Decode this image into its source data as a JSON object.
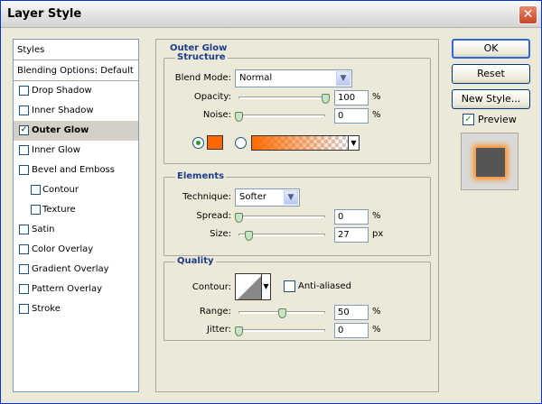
{
  "window": {
    "title": "Layer Style",
    "close_glyph": "✕"
  },
  "styles_panel": {
    "header": "Styles",
    "blending_options": "Blending Options: Default",
    "items": [
      {
        "label": "Drop Shadow",
        "checked": false,
        "indent": false,
        "selected": false
      },
      {
        "label": "Inner Shadow",
        "checked": false,
        "indent": false,
        "selected": false
      },
      {
        "label": "Outer Glow",
        "checked": true,
        "indent": false,
        "selected": true
      },
      {
        "label": "Inner Glow",
        "checked": false,
        "indent": false,
        "selected": false
      },
      {
        "label": "Bevel and Emboss",
        "checked": false,
        "indent": false,
        "selected": false
      },
      {
        "label": "Contour",
        "checked": false,
        "indent": true,
        "selected": false
      },
      {
        "label": "Texture",
        "checked": false,
        "indent": true,
        "selected": false
      },
      {
        "label": "Satin",
        "checked": false,
        "indent": false,
        "selected": false
      },
      {
        "label": "Color Overlay",
        "checked": false,
        "indent": false,
        "selected": false
      },
      {
        "label": "Gradient Overlay",
        "checked": false,
        "indent": false,
        "selected": false
      },
      {
        "label": "Pattern Overlay",
        "checked": false,
        "indent": false,
        "selected": false
      },
      {
        "label": "Stroke",
        "checked": false,
        "indent": false,
        "selected": false
      }
    ]
  },
  "outer_glow": {
    "title": "Outer Glow",
    "structure": {
      "title": "Structure",
      "blend_mode_label": "Blend Mode:",
      "blend_mode_value": "Normal",
      "opacity_label": "Opacity:",
      "opacity_value": "100",
      "opacity_pct": 1.0,
      "noise_label": "Noise:",
      "noise_value": "0",
      "noise_pct": 0.0,
      "unit_percent": "%",
      "glow_color": "#ff6600"
    },
    "elements": {
      "title": "Elements",
      "technique_label": "Technique:",
      "technique_value": "Softer",
      "spread_label": "Spread:",
      "spread_value": "0",
      "spread_pct": 0.0,
      "size_label": "Size:",
      "size_value": "27",
      "size_pct": 0.11,
      "unit_percent": "%",
      "unit_px": "px"
    },
    "quality": {
      "title": "Quality",
      "contour_label": "Contour:",
      "anti_aliased_label": "Anti-aliased",
      "anti_aliased_checked": false,
      "range_label": "Range:",
      "range_value": "50",
      "range_pct": 0.5,
      "jitter_label": "Jitter:",
      "jitter_value": "0",
      "jitter_pct": 0.0,
      "unit_percent": "%"
    }
  },
  "buttons": {
    "ok": "OK",
    "reset": "Reset",
    "new_style": "New Style...",
    "preview_label": "Preview",
    "preview_checked": true
  }
}
